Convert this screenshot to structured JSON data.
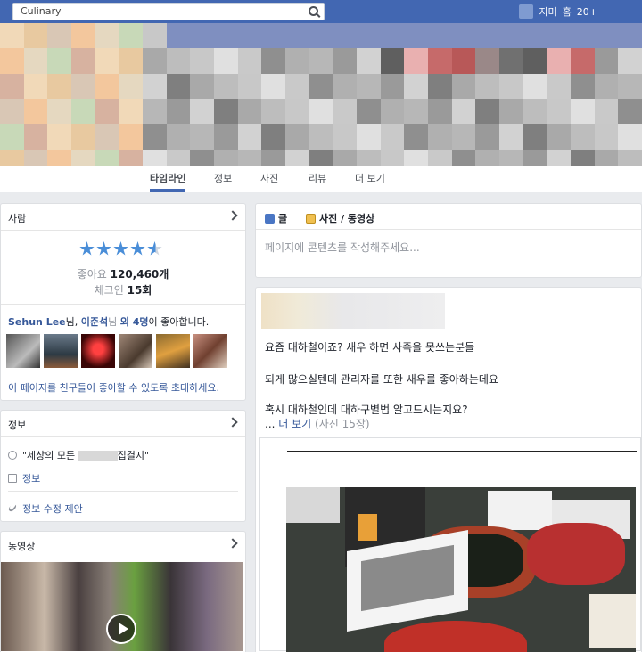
{
  "topbar": {
    "search_text": "Culinary",
    "user_name": "지미",
    "home_label": "홈",
    "badge": "20+"
  },
  "tabs": [
    "타임라인",
    "정보",
    "사진",
    "리뷰",
    "더 보기"
  ],
  "people_card": {
    "title": "사람",
    "rating": 4.5,
    "likes_label": "좋아요",
    "likes_value": "120,460개",
    "checkins_label": "체크인",
    "checkins_value": "15회",
    "friends_name1": "Sehun Lee",
    "friends_suffix1": "님, ",
    "friends_name2": "이준석",
    "friends_suffix2": "님 ",
    "friends_more": "외 4명",
    "friends_tail": "이 좋아합니다.",
    "invite_text": "이 페이지를 친구들이 좋아할 수 있도록 초대하세요."
  },
  "info_card": {
    "title": "정보",
    "tagline_start": "\"세상의 모든 ",
    "tagline_end": "집결지\"",
    "info_link": "정보",
    "suggest_edit": "정보 수정 제안"
  },
  "video_card": {
    "title": "동영상"
  },
  "composer": {
    "tab_post": "글",
    "tab_photo": "사진 / 동영상",
    "placeholder": "페이지에 콘텐츠를 작성해주세요..."
  },
  "post": {
    "line1": "요즘 대하철이죠? 새우 하면 사족을 못쓰는분들",
    "line2": "되게 많으실텐데 관리자를 또한 새우를 좋아하는데요",
    "line3": "혹시 대하철인데 대하구별법 알고드시는지요?",
    "more_prefix": "... ",
    "more_link": "더 보기",
    "more_count": "(사진 15장)"
  },
  "colors": {
    "brand": "#4267b2",
    "link": "#365899",
    "star": "#4a8ed8"
  }
}
